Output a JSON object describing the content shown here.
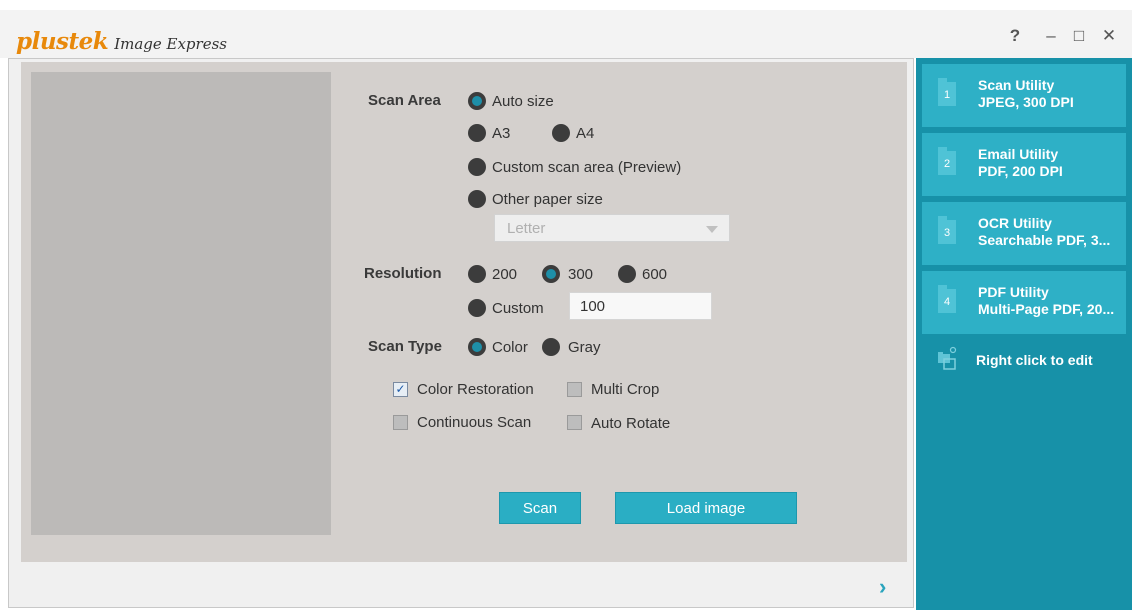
{
  "app": {
    "brand": "plustek",
    "product": "Image Express"
  },
  "window_controls": {
    "help": "?",
    "minimize": "–",
    "maximize": "□",
    "close": "✕"
  },
  "scan_area": {
    "label": "Scan Area",
    "options": {
      "auto_size": "Auto size",
      "a3": "A3",
      "a4": "A4",
      "custom": "Custom scan area (Preview)",
      "other": "Other paper size"
    },
    "selected": "auto_size",
    "paper_size": "Letter"
  },
  "resolution": {
    "label": "Resolution",
    "options": {
      "r200": "200",
      "r300": "300",
      "r600": "600",
      "custom": "Custom"
    },
    "selected": "300",
    "custom_value": "100"
  },
  "scan_type": {
    "label": "Scan Type",
    "options": {
      "color": "Color",
      "gray": "Gray"
    },
    "selected": "color"
  },
  "checkboxes": {
    "color_restoration": {
      "label": "Color Restoration",
      "checked": true
    },
    "multi_crop": {
      "label": "Multi Crop",
      "checked": false
    },
    "continuous_scan": {
      "label": "Continuous Scan",
      "checked": false
    },
    "auto_rotate": {
      "label": "Auto Rotate",
      "checked": false
    }
  },
  "buttons": {
    "scan": "Scan",
    "load_image": "Load image",
    "next": "›"
  },
  "utilities": [
    {
      "number": "1",
      "name": "Scan Utility",
      "detail": "JPEG, 300 DPI"
    },
    {
      "number": "2",
      "name": "Email Utility",
      "detail": "PDF, 200 DPI"
    },
    {
      "number": "3",
      "name": "OCR Utility",
      "detail": "Searchable PDF, 3..."
    },
    {
      "number": "4",
      "name": "PDF Utility",
      "detail": "Multi-Page PDF, 20..."
    }
  ],
  "edit_hint": "Right click to edit",
  "colors": {
    "accent": "#2aaec4",
    "sidebar": "#1791a8",
    "brand": "#e8890b"
  }
}
